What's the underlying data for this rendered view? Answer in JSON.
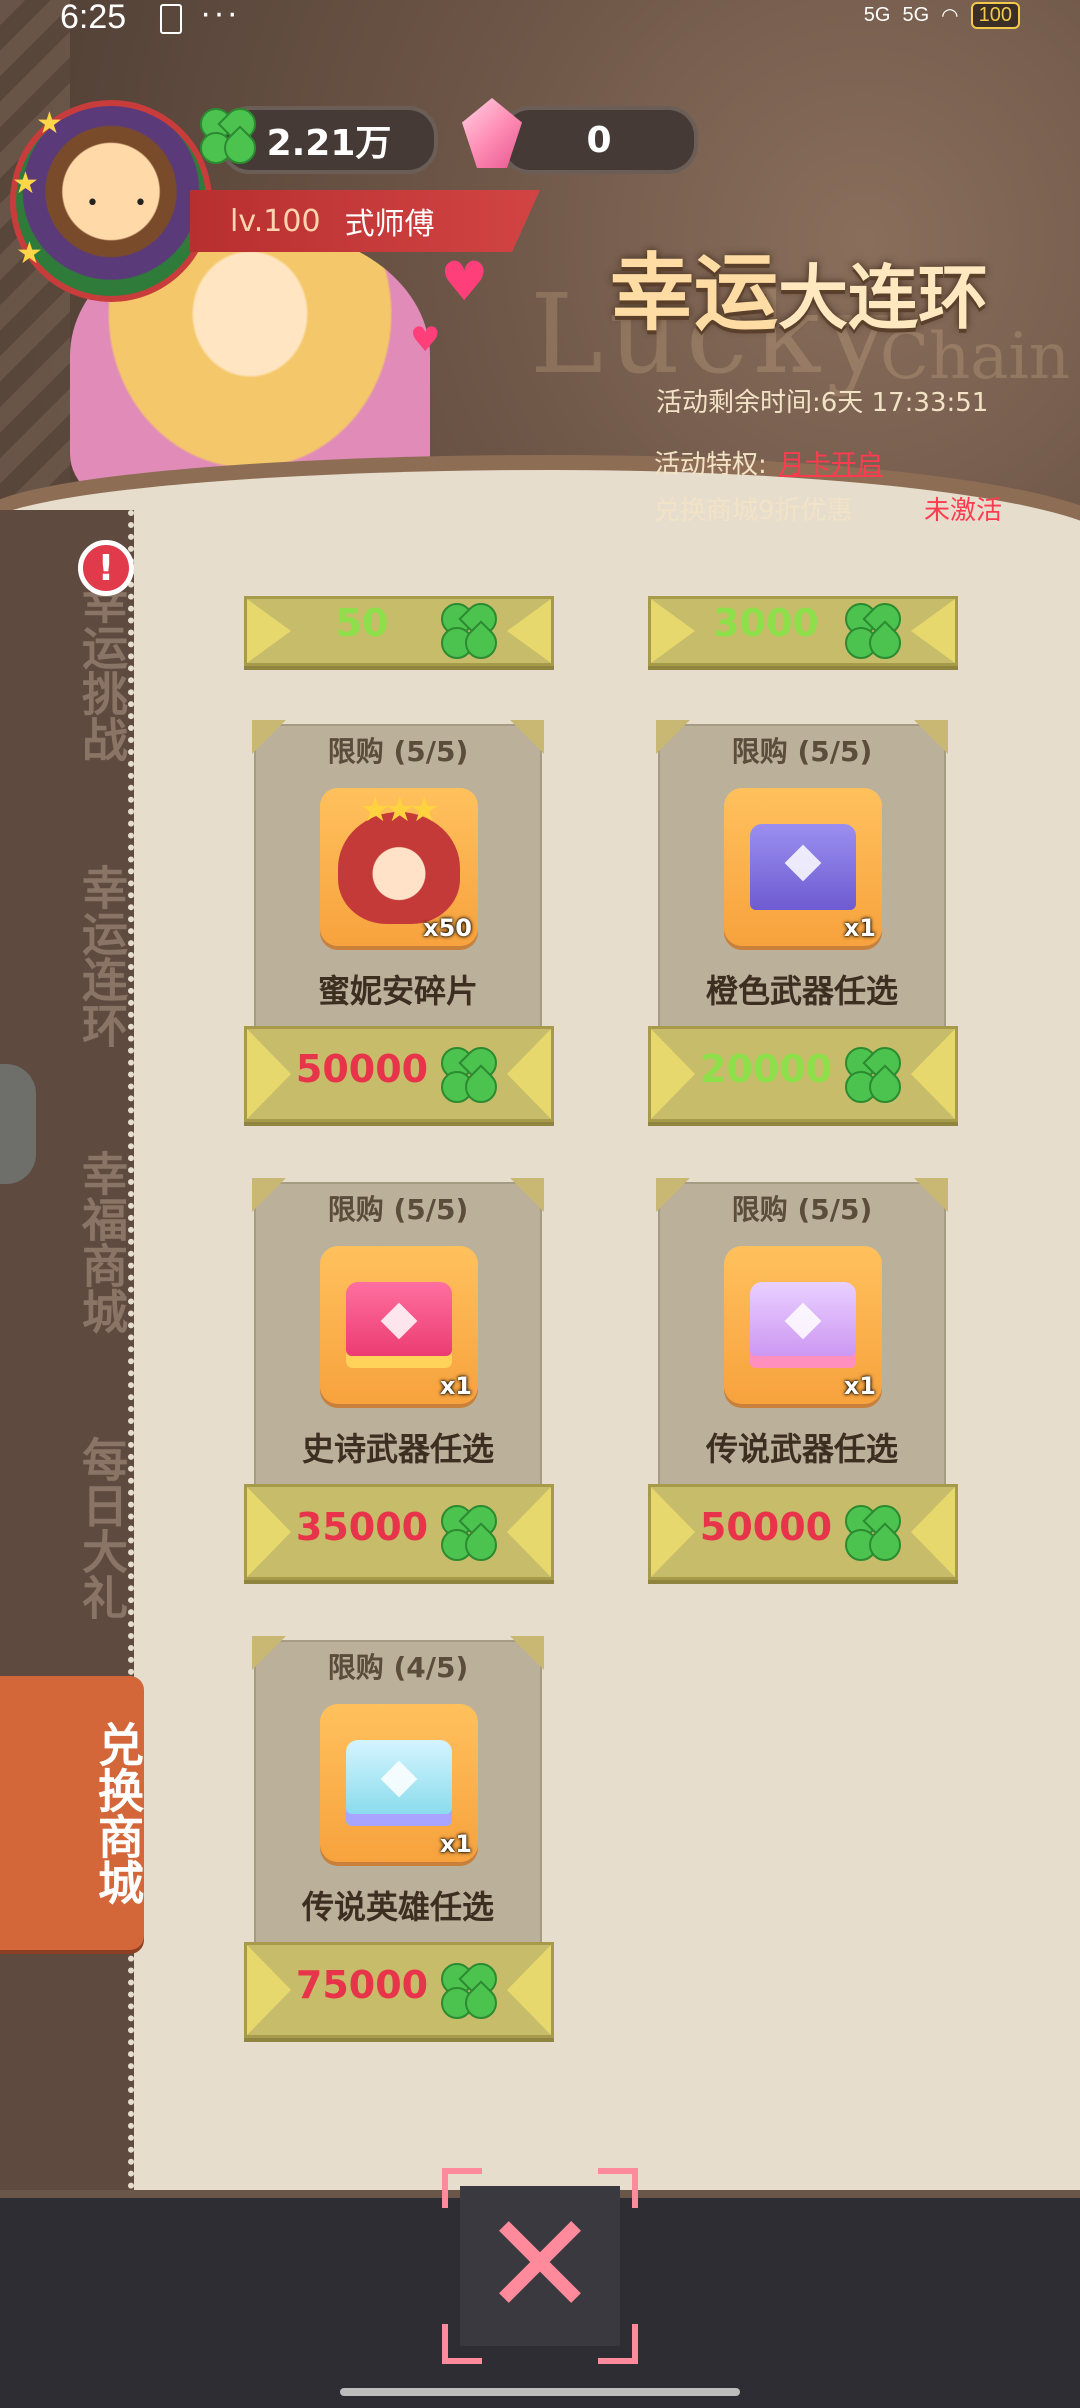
{
  "status_bar": {
    "time": "6:25",
    "dots": "···",
    "signal1": "5G",
    "signal2": "5G",
    "battery": "100"
  },
  "header": {
    "clover_count": "2.21万",
    "gem_count": "0",
    "level": "lv.100",
    "player_name": "式师傅"
  },
  "event": {
    "title_main": "幸运",
    "title_rest": "大连环",
    "bg_text_1": "Lucky",
    "bg_text_2": "Chain",
    "time_remaining": "活动剩余时间:6天 17:33:51",
    "privilege_label": "活动特权:",
    "privilege_link": "月卡开启",
    "discount_label": "兑换商城9折优惠",
    "discount_status": "未激活"
  },
  "sidebar": {
    "alert": "!",
    "tabs": [
      {
        "label": "幸运挑战"
      },
      {
        "label": "幸运连环"
      },
      {
        "label": "幸福商城"
      },
      {
        "label": "每日大礼"
      },
      {
        "label": "兑换商城"
      }
    ],
    "active_index": 4
  },
  "shop": {
    "top_partial": [
      {
        "price": "50"
      },
      {
        "price": "3000"
      }
    ],
    "items": [
      {
        "limit": "限购 (5/5)",
        "name": "蜜妮安碎片",
        "qty": "x50",
        "price": "50000",
        "price_color": "red",
        "icon": "hero-portrait"
      },
      {
        "limit": "限购 (5/5)",
        "name": "橙色武器任选",
        "qty": "x1",
        "price": "20000",
        "price_color": "green",
        "icon": "purple-chest"
      },
      {
        "limit": "限购 (5/5)",
        "name": "史诗武器任选",
        "qty": "x1",
        "price": "35000",
        "price_color": "red",
        "icon": "red-chest"
      },
      {
        "limit": "限购 (5/5)",
        "name": "传说武器任选",
        "qty": "x1",
        "price": "50000",
        "price_color": "red",
        "icon": "pink-chest"
      },
      {
        "limit": "限购 (4/5)",
        "name": "传说英雄任选",
        "qty": "x1",
        "price": "75000",
        "price_color": "red",
        "icon": "cyan-chest"
      }
    ]
  },
  "close_button": {
    "icon": "close-icon",
    "glyph": "✕"
  }
}
